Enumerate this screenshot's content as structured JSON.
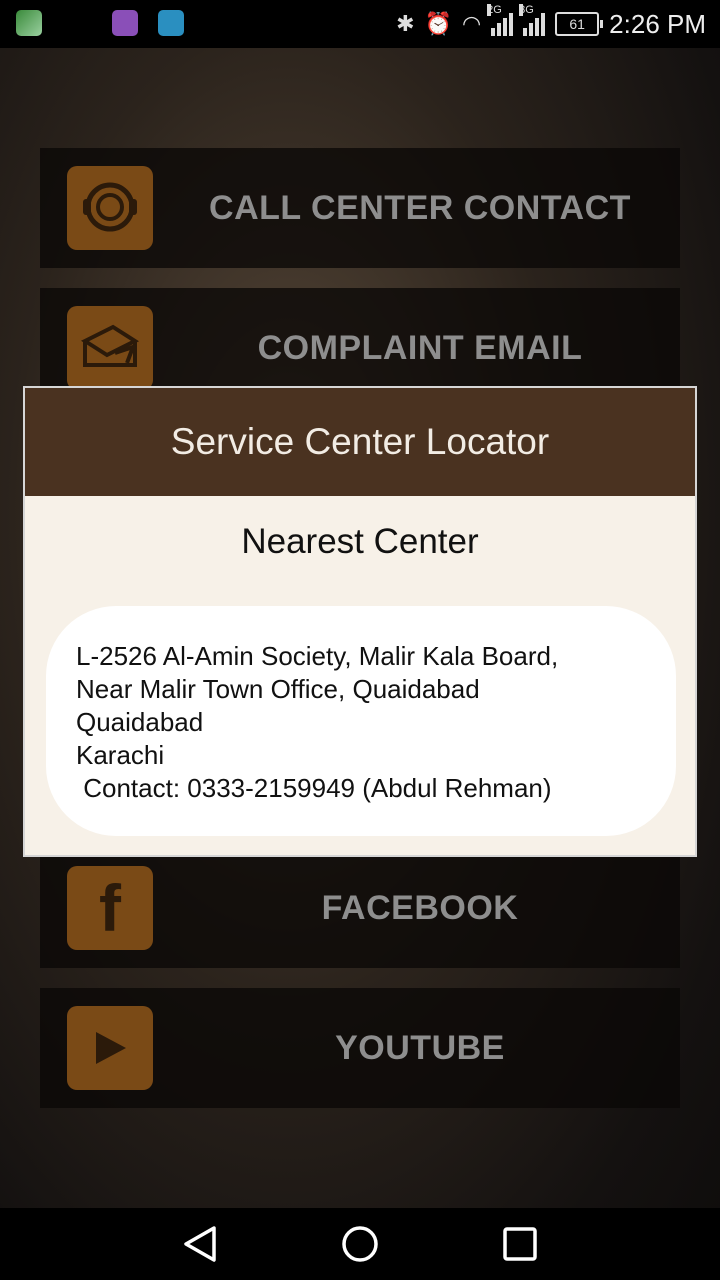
{
  "status_bar": {
    "time": "2:26 PM",
    "battery": "61",
    "net1": "2G",
    "net2": "3G"
  },
  "menu": {
    "items": [
      {
        "label": "CALL CENTER CONTACT",
        "icon": "headset-icon"
      },
      {
        "label": "COMPLAINT EMAIL",
        "icon": "email-icon"
      },
      {
        "label": "FACEBOOK",
        "icon": "facebook-icon"
      },
      {
        "label": "YOUTUBE",
        "icon": "play-icon"
      }
    ]
  },
  "dialog": {
    "title": "Service Center Locator",
    "subtitle": "Nearest Center",
    "address_lines": [
      "L-2526 Al-Amin Society, Malir Kala Board,",
      "Near Malir Town Office, Quaidabad",
      "Quaidabad",
      "Karachi",
      " Contact: 0333-2159949 (Abdul Rehman)"
    ]
  },
  "colors": {
    "dialog_header": "#4a3220",
    "dialog_body": "#f7f1e8",
    "tile_icon": "#7a4a16"
  }
}
